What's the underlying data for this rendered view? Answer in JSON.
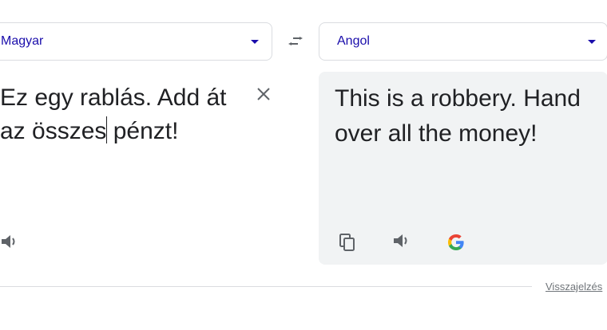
{
  "source": {
    "language": "Magyar",
    "text_before_cursor": "Ez egy rablás. Add át az összes",
    "text_after_cursor": " pénzt!"
  },
  "target": {
    "language": "Angol",
    "text": "This is a robbery. Hand over all the money!"
  },
  "icons": {
    "swap": "swap-arrows-icon",
    "clear": "close-icon",
    "source_listen": "speaker-icon",
    "copy": "copy-icon",
    "target_listen": "speaker-icon",
    "google": "google-logo-icon"
  },
  "footer": {
    "feedback_label": "Visszajelzés"
  },
  "colors": {
    "link_blue": "#1a0dab",
    "panel_grey": "#f1f3f4",
    "border": "#dadce0",
    "text": "#202124",
    "icon_grey": "#5f6368"
  }
}
